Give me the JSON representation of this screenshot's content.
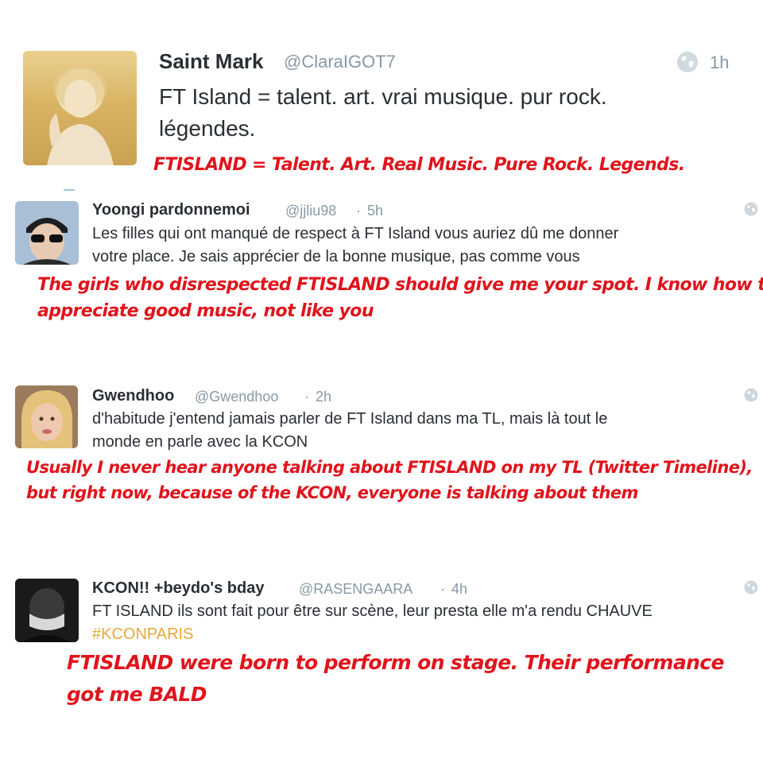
{
  "tweets": [
    {
      "name": "Saint Mark",
      "handle": "@ClaraIGOT7",
      "time": "1h",
      "text_line1": "FT Island = talent. art. vrai musique. pur rock.",
      "text_line2": "légendes.",
      "translation_line1": "FTISLAND = Talent. Art. Real Music. Pure Rock. Legends.",
      "avatar_icon": "avatar-golden-portrait"
    },
    {
      "name": "Yoongi pardonnemoi",
      "handle": "@jjliu98",
      "sep": "·",
      "time": "5h",
      "text_line1": "Les filles qui ont manqué de respect à FT Island vous auriez dû me donner",
      "text_line2": "votre place. Je sais apprécier de la bonne musique, pas comme vous",
      "translation_line1": "The girls who disrespected FTISLAND should give me your spot. I know how to",
      "translation_line2": "appreciate good music, not like you",
      "avatar_icon": "avatar-sunglasses-cap"
    },
    {
      "name": "Gwendhoo",
      "handle": "@Gwendhoo",
      "sep": "·",
      "time": "2h",
      "text_line1": "d'habitude j'entend jamais parler de FT Island dans ma TL, mais là tout le",
      "text_line2": "monde en parle avec la KCON",
      "translation_line1": "Usually I never hear anyone talking about FTISLAND on my TL (Twitter Timeline),",
      "translation_line2": "but right now, because of the KCON, everyone is talking about them",
      "avatar_icon": "avatar-blonde"
    },
    {
      "name": "KCON!! +beydo's bday",
      "handle": "@RASENGAARA",
      "sep": "·",
      "time": "4h",
      "text_line1": "FT ISLAND ils sont fait pour être sur scène, leur presta elle m'a rendu CHAUVE",
      "hashtag": "#KCONPARIS",
      "translation_line1": "FTISLAND were born to perform on stage. Their performance",
      "translation_line2": "got me BALD",
      "avatar_icon": "avatar-dark-mask"
    }
  ],
  "colors": {
    "name": "#292f33",
    "meta": "#8899a6",
    "hashtag": "#e8a93a",
    "translation": "#e0141c"
  },
  "icons": [
    "globe-icon"
  ]
}
